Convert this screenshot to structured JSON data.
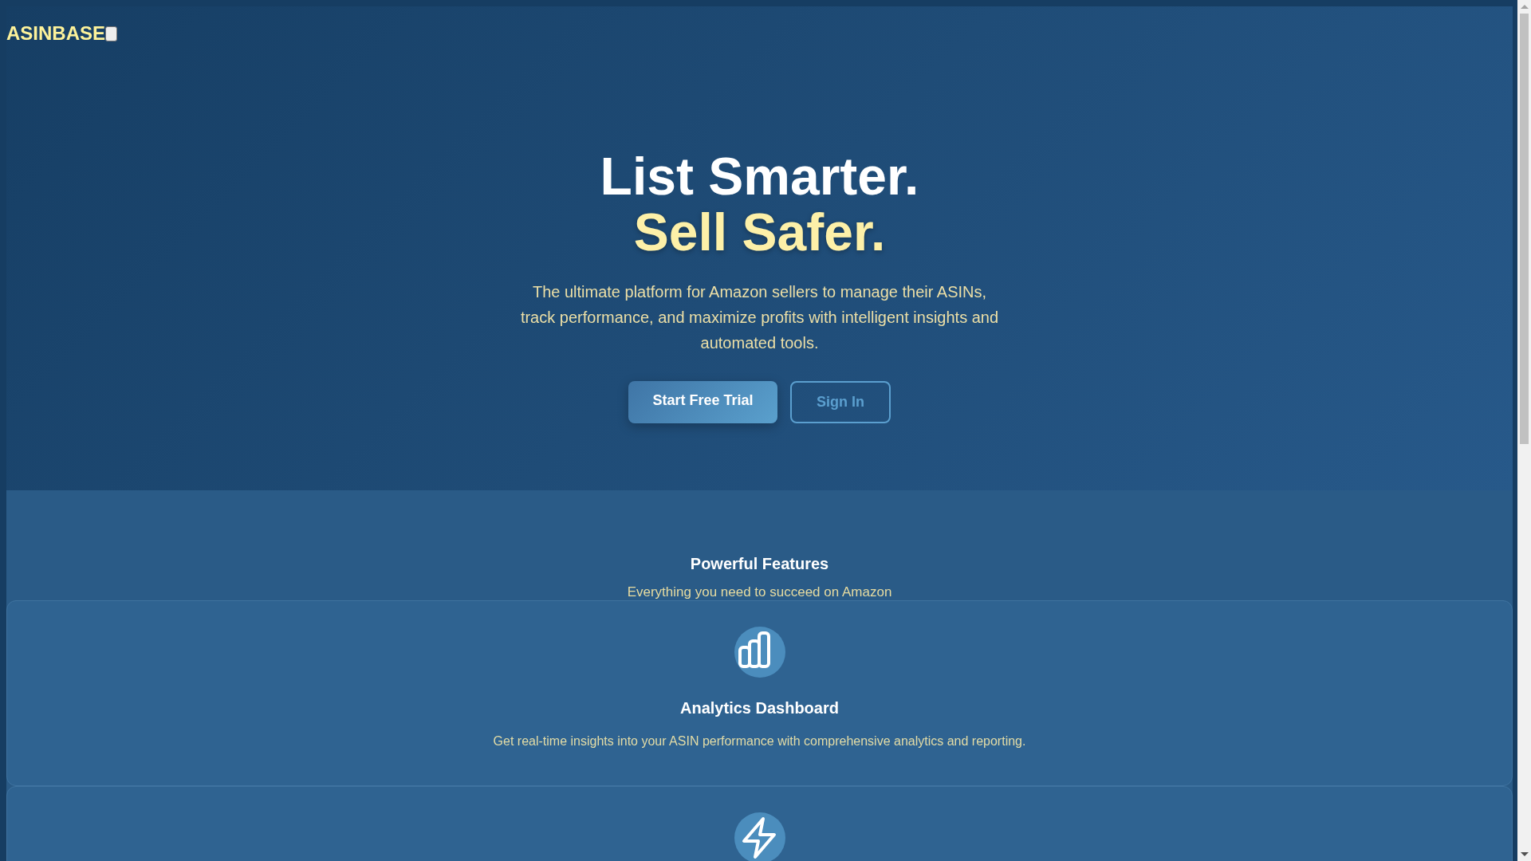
{
  "header": {
    "logo": "ASINBASE"
  },
  "hero": {
    "title_line_1": "List Smarter.",
    "title_line_2": "Sell Safer.",
    "description": "The ultimate platform for Amazon sellers to manage their ASINs, track performance, and maximize profits with intelligent insights and automated tools.",
    "buttons": [
      {
        "label": "Start Free Trial",
        "kind": "primary"
      },
      {
        "label": "Sign In",
        "kind": "outline"
      }
    ]
  },
  "features": {
    "heading": "Powerful Features",
    "subheading": "Everything you need to succeed on Amazon",
    "items": [
      {
        "kind": "full",
        "title": "Analytics Dashboard",
        "description": "Get real-time insights into your ASIN performance with comprehensive analytics and reporting."
      },
      {
        "kind": "cut"
      }
    ]
  }
}
